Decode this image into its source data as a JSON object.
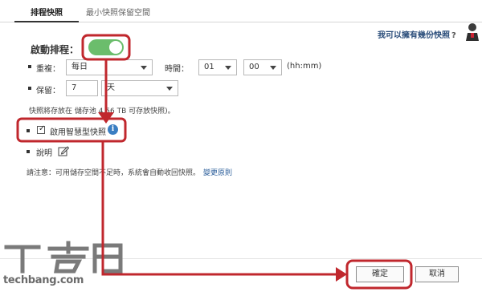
{
  "tabs": [
    {
      "label": "排程快照"
    },
    {
      "label": "最小快照保留空間"
    }
  ],
  "help": {
    "text": "我可以擁有幾份快照",
    "mark": "?"
  },
  "schedule": {
    "enable_label": "啟動排程：",
    "enabled": true,
    "repeat_label": "重複：",
    "repeat_value": "每日",
    "time_label": "時間：",
    "hour_value": "01",
    "minute_value": "00",
    "time_format": "(hh:mm)",
    "retain_label": "保留：",
    "retain_value": "7",
    "retain_unit": "天"
  },
  "storage_info": "快照將存放在 儲存池 4.56 TB 可存放快照)。",
  "smart_snapshot": {
    "label": "啟用智慧型快照",
    "checked": true,
    "check_glyph": "✓",
    "info_glyph": "i"
  },
  "description": {
    "label": "說明"
  },
  "notice": {
    "text": "請注意：可用儲存空間不足時，系統會自動收回快照。",
    "link": "變更原則"
  },
  "buttons": {
    "ok": "確定",
    "cancel": "取消"
  },
  "watermark": {
    "text": "techbang.com"
  },
  "colors": {
    "toggle_on": "#6bbd6c",
    "highlight": "#c0272d",
    "link": "#2a5d9a",
    "info": "#3a7ec2"
  },
  "icons": [
    "toggle-switch",
    "checkbox-checked",
    "info-icon",
    "edit-icon",
    "caret-down-icon",
    "help-avatar-icon",
    "arrow-annotation"
  ]
}
